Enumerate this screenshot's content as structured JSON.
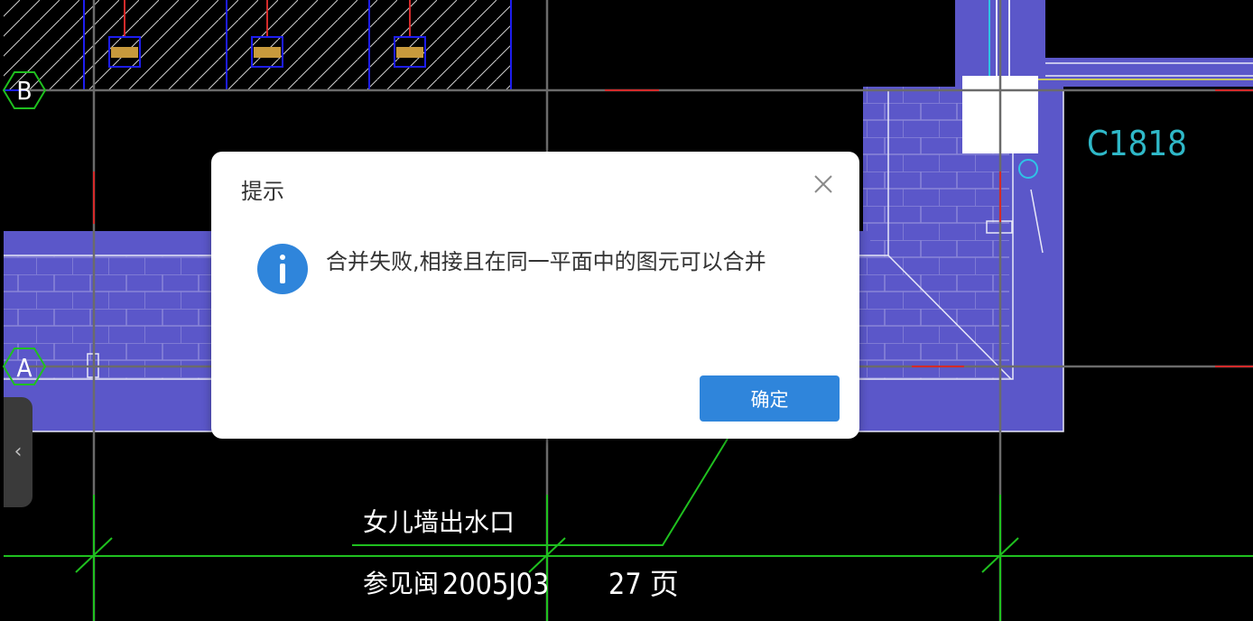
{
  "drawing": {
    "axis_labels": {
      "b": "B",
      "a": "A"
    },
    "window_label": "C1818",
    "annotation_line1": "女儿墙出水口",
    "annotation_line2_prefix": "参见闽",
    "annotation_line2_code": "2005J03",
    "annotation_line2_page": "27 页",
    "colors": {
      "wall": "#5b57c9",
      "grid": "#6b6b6b",
      "green": "#1fc01f",
      "cyan": "#2fc3e6",
      "red": "#d42a2a",
      "blue": "#1d1df0"
    }
  },
  "side_handle": {
    "icon": "chevron-left-icon",
    "glyph": "‹"
  },
  "dialog": {
    "title": "提示",
    "close_icon": "close-icon",
    "info_icon": "info-icon",
    "message": "合并失败,相接且在同一平面中的图元可以合并",
    "ok_label": "确定",
    "accent": "#2f85db"
  }
}
